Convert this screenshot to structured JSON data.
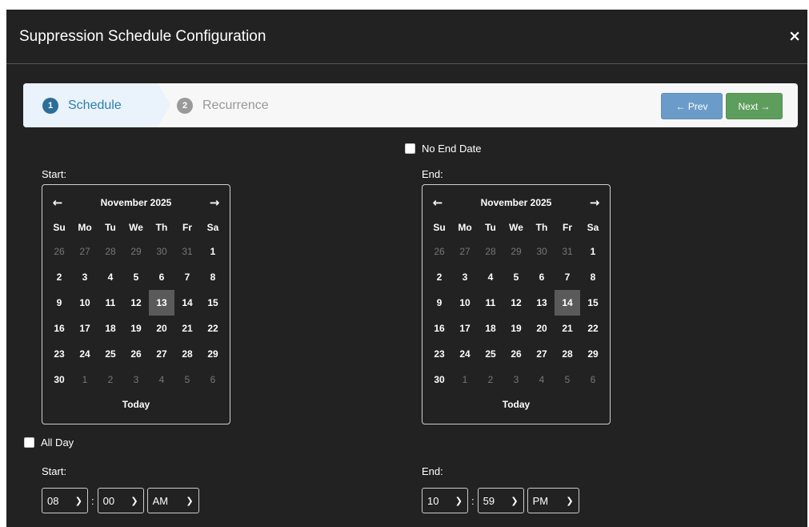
{
  "modal": {
    "title": "Suppression Schedule Configuration",
    "close_label": "×"
  },
  "wizard": {
    "steps": [
      {
        "num": "1",
        "label": "Schedule"
      },
      {
        "num": "2",
        "label": "Recurrence"
      }
    ],
    "prev_label": "← Prev",
    "next_label": "Next →"
  },
  "no_end_date_label": "No End Date",
  "all_day_label": "All Day",
  "start": {
    "label": "Start:",
    "calendar": {
      "month": "November 2025",
      "prev_icon": "←",
      "next_icon": "→",
      "weekdays": [
        "Su",
        "Mo",
        "Tu",
        "We",
        "Th",
        "Fr",
        "Sa"
      ],
      "weeks": [
        [
          "26",
          "27",
          "28",
          "29",
          "30",
          "31",
          "1"
        ],
        [
          "2",
          "3",
          "4",
          "5",
          "6",
          "7",
          "8"
        ],
        [
          "9",
          "10",
          "11",
          "12",
          "13",
          "14",
          "15"
        ],
        [
          "16",
          "17",
          "18",
          "19",
          "20",
          "21",
          "22"
        ],
        [
          "23",
          "24",
          "25",
          "26",
          "27",
          "28",
          "29"
        ],
        [
          "30",
          "1",
          "2",
          "3",
          "4",
          "5",
          "6"
        ]
      ],
      "selected": "13",
      "today_label": "Today"
    },
    "time_label": "Start:",
    "hour": "08",
    "minute": "00",
    "ampm": "AM"
  },
  "end": {
    "label": "End:",
    "calendar": {
      "month": "November 2025",
      "prev_icon": "←",
      "next_icon": "→",
      "weekdays": [
        "Su",
        "Mo",
        "Tu",
        "We",
        "Th",
        "Fr",
        "Sa"
      ],
      "weeks": [
        [
          "26",
          "27",
          "28",
          "29",
          "30",
          "31",
          "1"
        ],
        [
          "2",
          "3",
          "4",
          "5",
          "6",
          "7",
          "8"
        ],
        [
          "9",
          "10",
          "11",
          "12",
          "13",
          "14",
          "15"
        ],
        [
          "16",
          "17",
          "18",
          "19",
          "20",
          "21",
          "22"
        ],
        [
          "23",
          "24",
          "25",
          "26",
          "27",
          "28",
          "29"
        ],
        [
          "30",
          "1",
          "2",
          "3",
          "4",
          "5",
          "6"
        ]
      ],
      "selected": "14",
      "today_label": "Today"
    },
    "time_label": "End:",
    "hour": "10",
    "minute": "59",
    "ampm": "PM"
  },
  "colors": {
    "modal_bg": "#222222",
    "step_active": "#2c7fb0",
    "prev_button": "#6b9cc9",
    "next_button": "#5d9e5d",
    "selected_day": "#5a5a5a"
  },
  "icons": {
    "close": "close-icon",
    "prev_month": "arrow-left-icon",
    "next_month": "arrow-right-icon",
    "select": "chevron-down-icon"
  }
}
